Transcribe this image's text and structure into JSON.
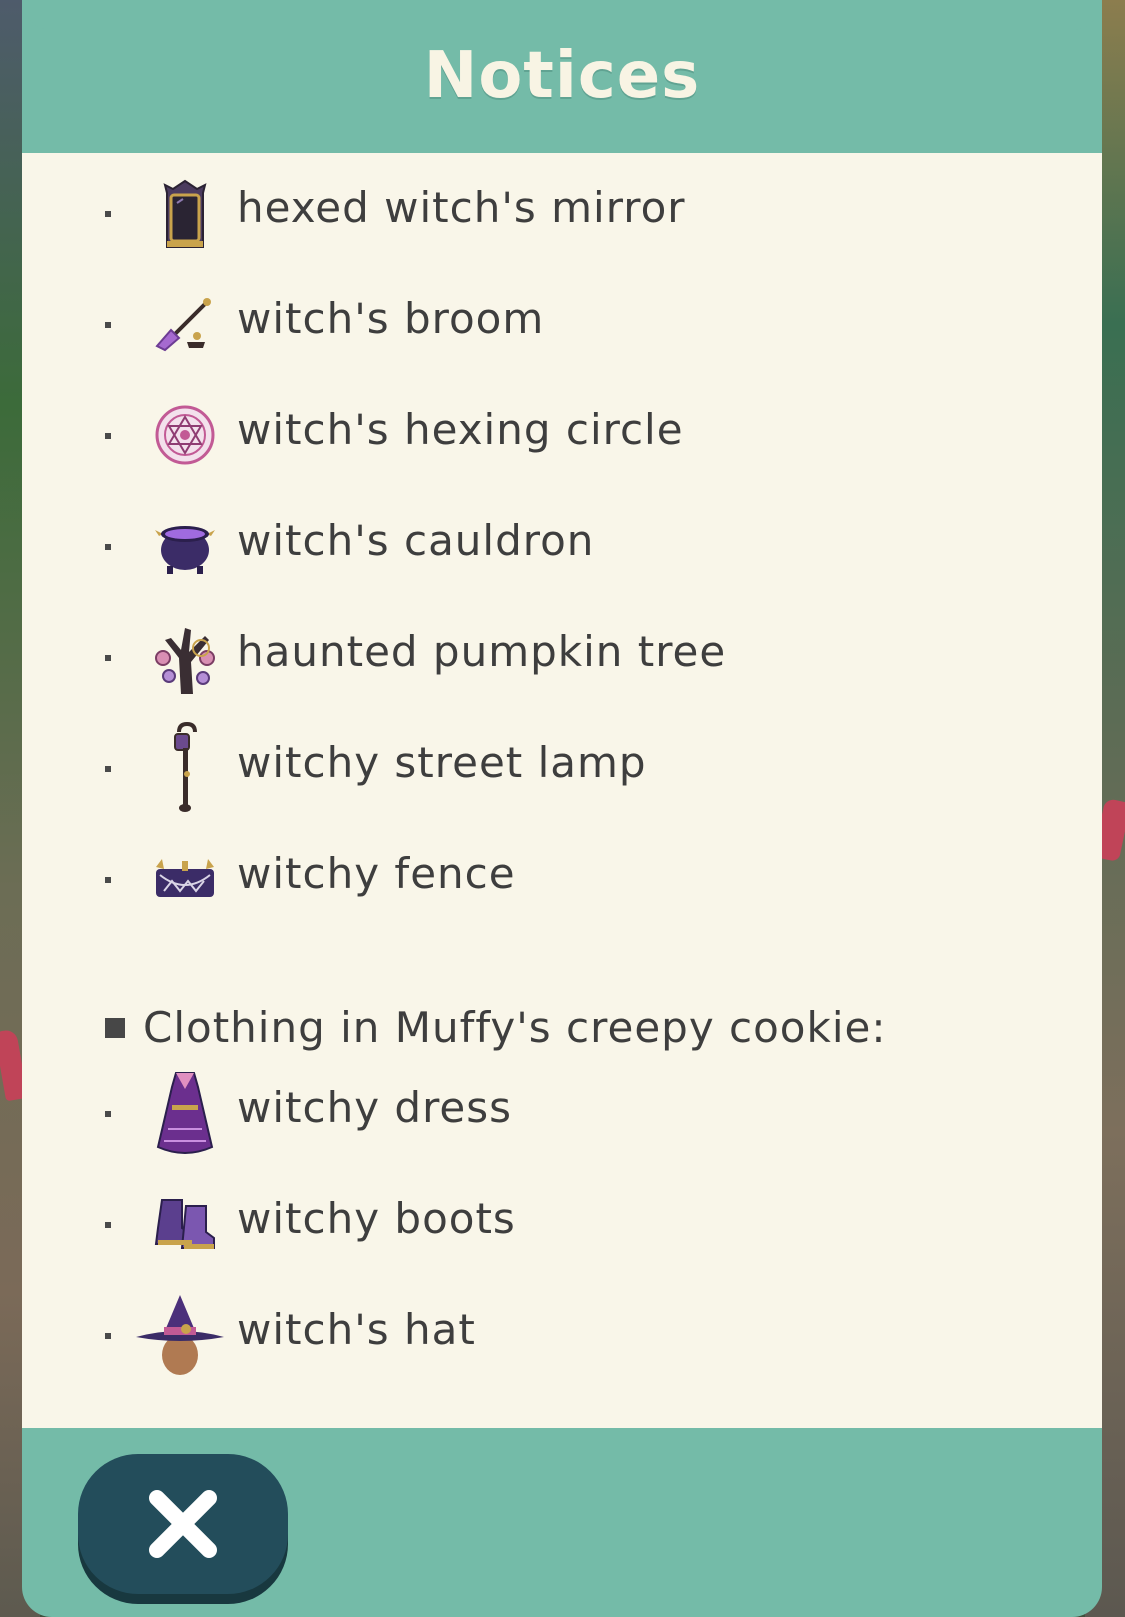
{
  "dialog": {
    "title": "Notices",
    "items": [
      {
        "label": "hexed witch's mirror",
        "icon": "mirror-icon"
      },
      {
        "label": "witch's broom",
        "icon": "broom-icon"
      },
      {
        "label": "witch's hexing circle",
        "icon": "hexing-circle-icon"
      },
      {
        "label": "witch's cauldron",
        "icon": "cauldron-icon"
      },
      {
        "label": "haunted pumpkin tree",
        "icon": "pumpkin-tree-icon"
      },
      {
        "label": "witchy street lamp",
        "icon": "street-lamp-icon"
      },
      {
        "label": "witchy fence",
        "icon": "fence-icon"
      }
    ],
    "section_heading": "Clothing in Muffy's creepy cookie:",
    "clothing_items": [
      {
        "label": "witchy dress",
        "icon": "dress-icon"
      },
      {
        "label": "witchy boots",
        "icon": "boots-icon"
      },
      {
        "label": "witch's hat",
        "icon": "witch-hat-icon"
      }
    ],
    "close_icon": "close-icon"
  },
  "colors": {
    "header": "#74bba8",
    "panel": "#f9f6e9",
    "text": "#3e3e3e",
    "title_text": "#f8f4e4",
    "close_button": "#234d5b"
  }
}
